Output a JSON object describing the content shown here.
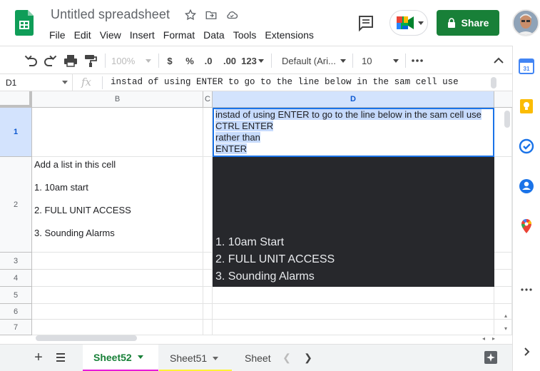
{
  "document": {
    "title": "Untitled spreadsheet"
  },
  "menu": [
    "File",
    "Edit",
    "View",
    "Insert",
    "Format",
    "Data",
    "Tools",
    "Extensions"
  ],
  "header": {
    "share_label": "Share"
  },
  "toolbar": {
    "zoom": "100%",
    "currency": "$",
    "percent": "%",
    "decrease_decimal": ".0",
    "increase_decimal": ".00",
    "more_formats": "123",
    "font": "Default (Ari...",
    "font_size": "10"
  },
  "formula_bar": {
    "cell_ref": "D1",
    "fx": "fx",
    "formula": "instad of using ENTER to go to the line below in the sam cell use"
  },
  "columns": [
    "B",
    "C",
    "D"
  ],
  "rows": [
    "1",
    "2",
    "3",
    "4",
    "5",
    "6",
    "7"
  ],
  "cells": {
    "D1": [
      "instad of using ENTER to go to the line below in the sam cell use",
      "CTRL ENTER",
      "rather than",
      "ENTER"
    ],
    "B2": [
      "Add a list in this cell",
      "1. 10am start",
      "2. FULL UNIT ACCESS",
      "3. Sounding Alarms"
    ],
    "D2": [
      "1. 10am Start",
      "2. FULL UNIT ACCESS",
      "3. Sounding Alarms"
    ]
  },
  "sheets": [
    {
      "name": "Sheet52",
      "active": true,
      "color": "#e61bd9"
    },
    {
      "name": "Sheet51",
      "active": false,
      "color": "#fff235"
    },
    {
      "name": "Sheet",
      "active": false,
      "color": ""
    }
  ],
  "colors": {
    "share_green": "#188038",
    "selection_blue": "#1a73e8",
    "dark_fill": "#27282c"
  },
  "icons": [
    "undo-icon",
    "redo-icon",
    "print-icon",
    "paint-format-icon",
    "more-icon",
    "collapse-icon",
    "comment-icon",
    "meet-icon",
    "lock-icon",
    "star-icon",
    "move-icon",
    "cloud-icon",
    "calendar-icon",
    "keep-icon",
    "tasks-icon",
    "contacts-icon",
    "maps-icon"
  ]
}
